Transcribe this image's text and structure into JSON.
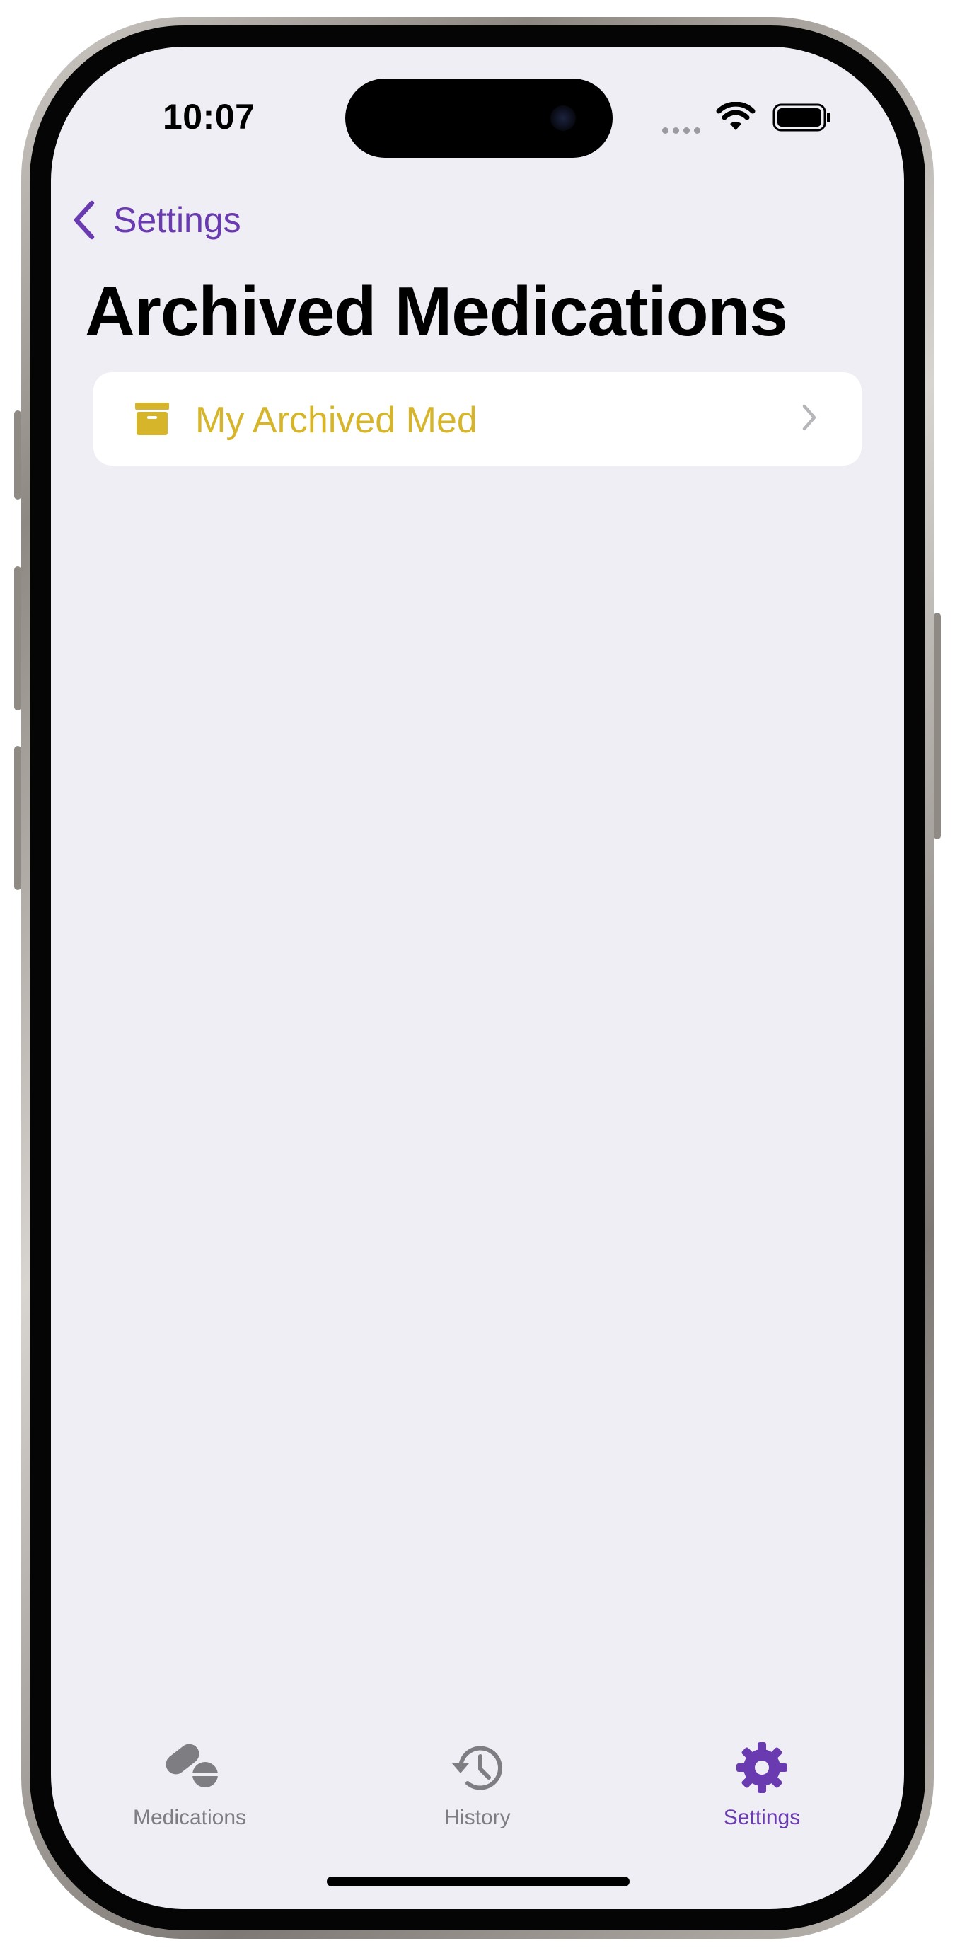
{
  "status_bar": {
    "time": "10:07",
    "icons": [
      "signal-dots-icon",
      "wifi-icon",
      "battery-icon"
    ]
  },
  "nav": {
    "back_label": "Settings",
    "back_icon": "chevron-left-icon",
    "title": "Archived Medications"
  },
  "archived_list": {
    "items": [
      {
        "label": "My Archived Med",
        "icon": "archive-box-icon",
        "accessory": "chevron-right-icon"
      }
    ]
  },
  "tab_bar": {
    "tabs": [
      {
        "label": "Medications",
        "icon": "pills-icon",
        "selected": false
      },
      {
        "label": "History",
        "icon": "history-clock-icon",
        "selected": false
      },
      {
        "label": "Settings",
        "icon": "gear-icon",
        "selected": true
      }
    ]
  },
  "colors": {
    "accent": "#6a3bb0",
    "item_text": "#d6b52a",
    "inactive_tab": "#7d7d82",
    "background": "#efeef5",
    "card": "#ffffff"
  }
}
